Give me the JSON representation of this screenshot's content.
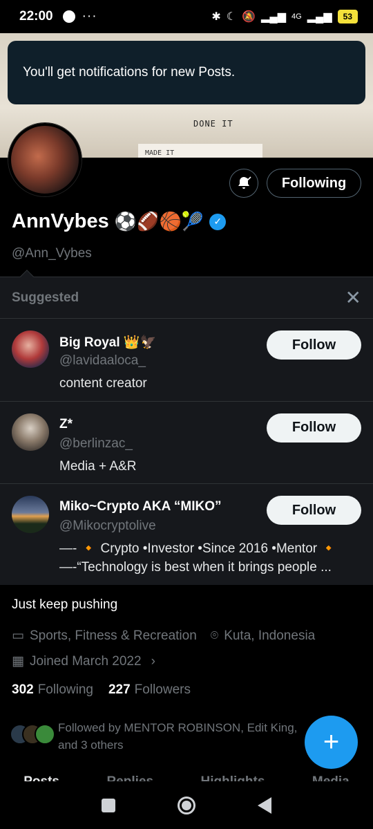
{
  "status_bar": {
    "time": "22:00",
    "dots": "···",
    "signal_label": "4G",
    "battery": "53"
  },
  "toast": {
    "message": "You'll get notifications for new Posts."
  },
  "banner": {
    "word_top": "DONE IT",
    "word_bottom": "MADE IT"
  },
  "profile": {
    "name": "AnnVybes",
    "name_emojis": "⚽🏈🏀🎾",
    "handle": "@Ann_Vybes",
    "following_button": "Following",
    "bio": "Just keep pushing",
    "category": "Sports, Fitness & Recreation",
    "location": "Kuta, Indonesia",
    "joined": "Joined March 2022",
    "following_count": "302",
    "following_label": "Following",
    "followers_count": "227",
    "followers_label": "Followers",
    "followed_by": "Followed by MENTOR ROBINSON, Edit King,",
    "followed_by_more": "and 3 others"
  },
  "suggested": {
    "title": "Suggested",
    "items": [
      {
        "name": "Big Royal 👑🦅",
        "handle": "@lavidaaloca_",
        "bio_lines": [
          "content creator"
        ],
        "button": "Follow",
        "avatar_color": "#b03a3a"
      },
      {
        "name": "Z*",
        "handle": "@berlinzac_",
        "bio_lines": [
          "Media + A&R"
        ],
        "button": "Follow",
        "avatar_color": "#8a7a6a"
      },
      {
        "name": "Miko~Crypto AKA “MIKO”",
        "handle": "@Mikocryptolive",
        "bio_lines": [
          "—- 🔸 Crypto •Investor •Since 2016 •Mentor 🔸",
          "—-“Technology is best when it brings people ..."
        ],
        "button": "Follow",
        "avatar_color": "#3b4a6a"
      }
    ]
  },
  "tabs": [
    "Posts",
    "Replies",
    "Highlights",
    "Media"
  ],
  "colors": {
    "accent": "#1d9bf0",
    "background": "#000000",
    "muted_text": "#71767b"
  }
}
